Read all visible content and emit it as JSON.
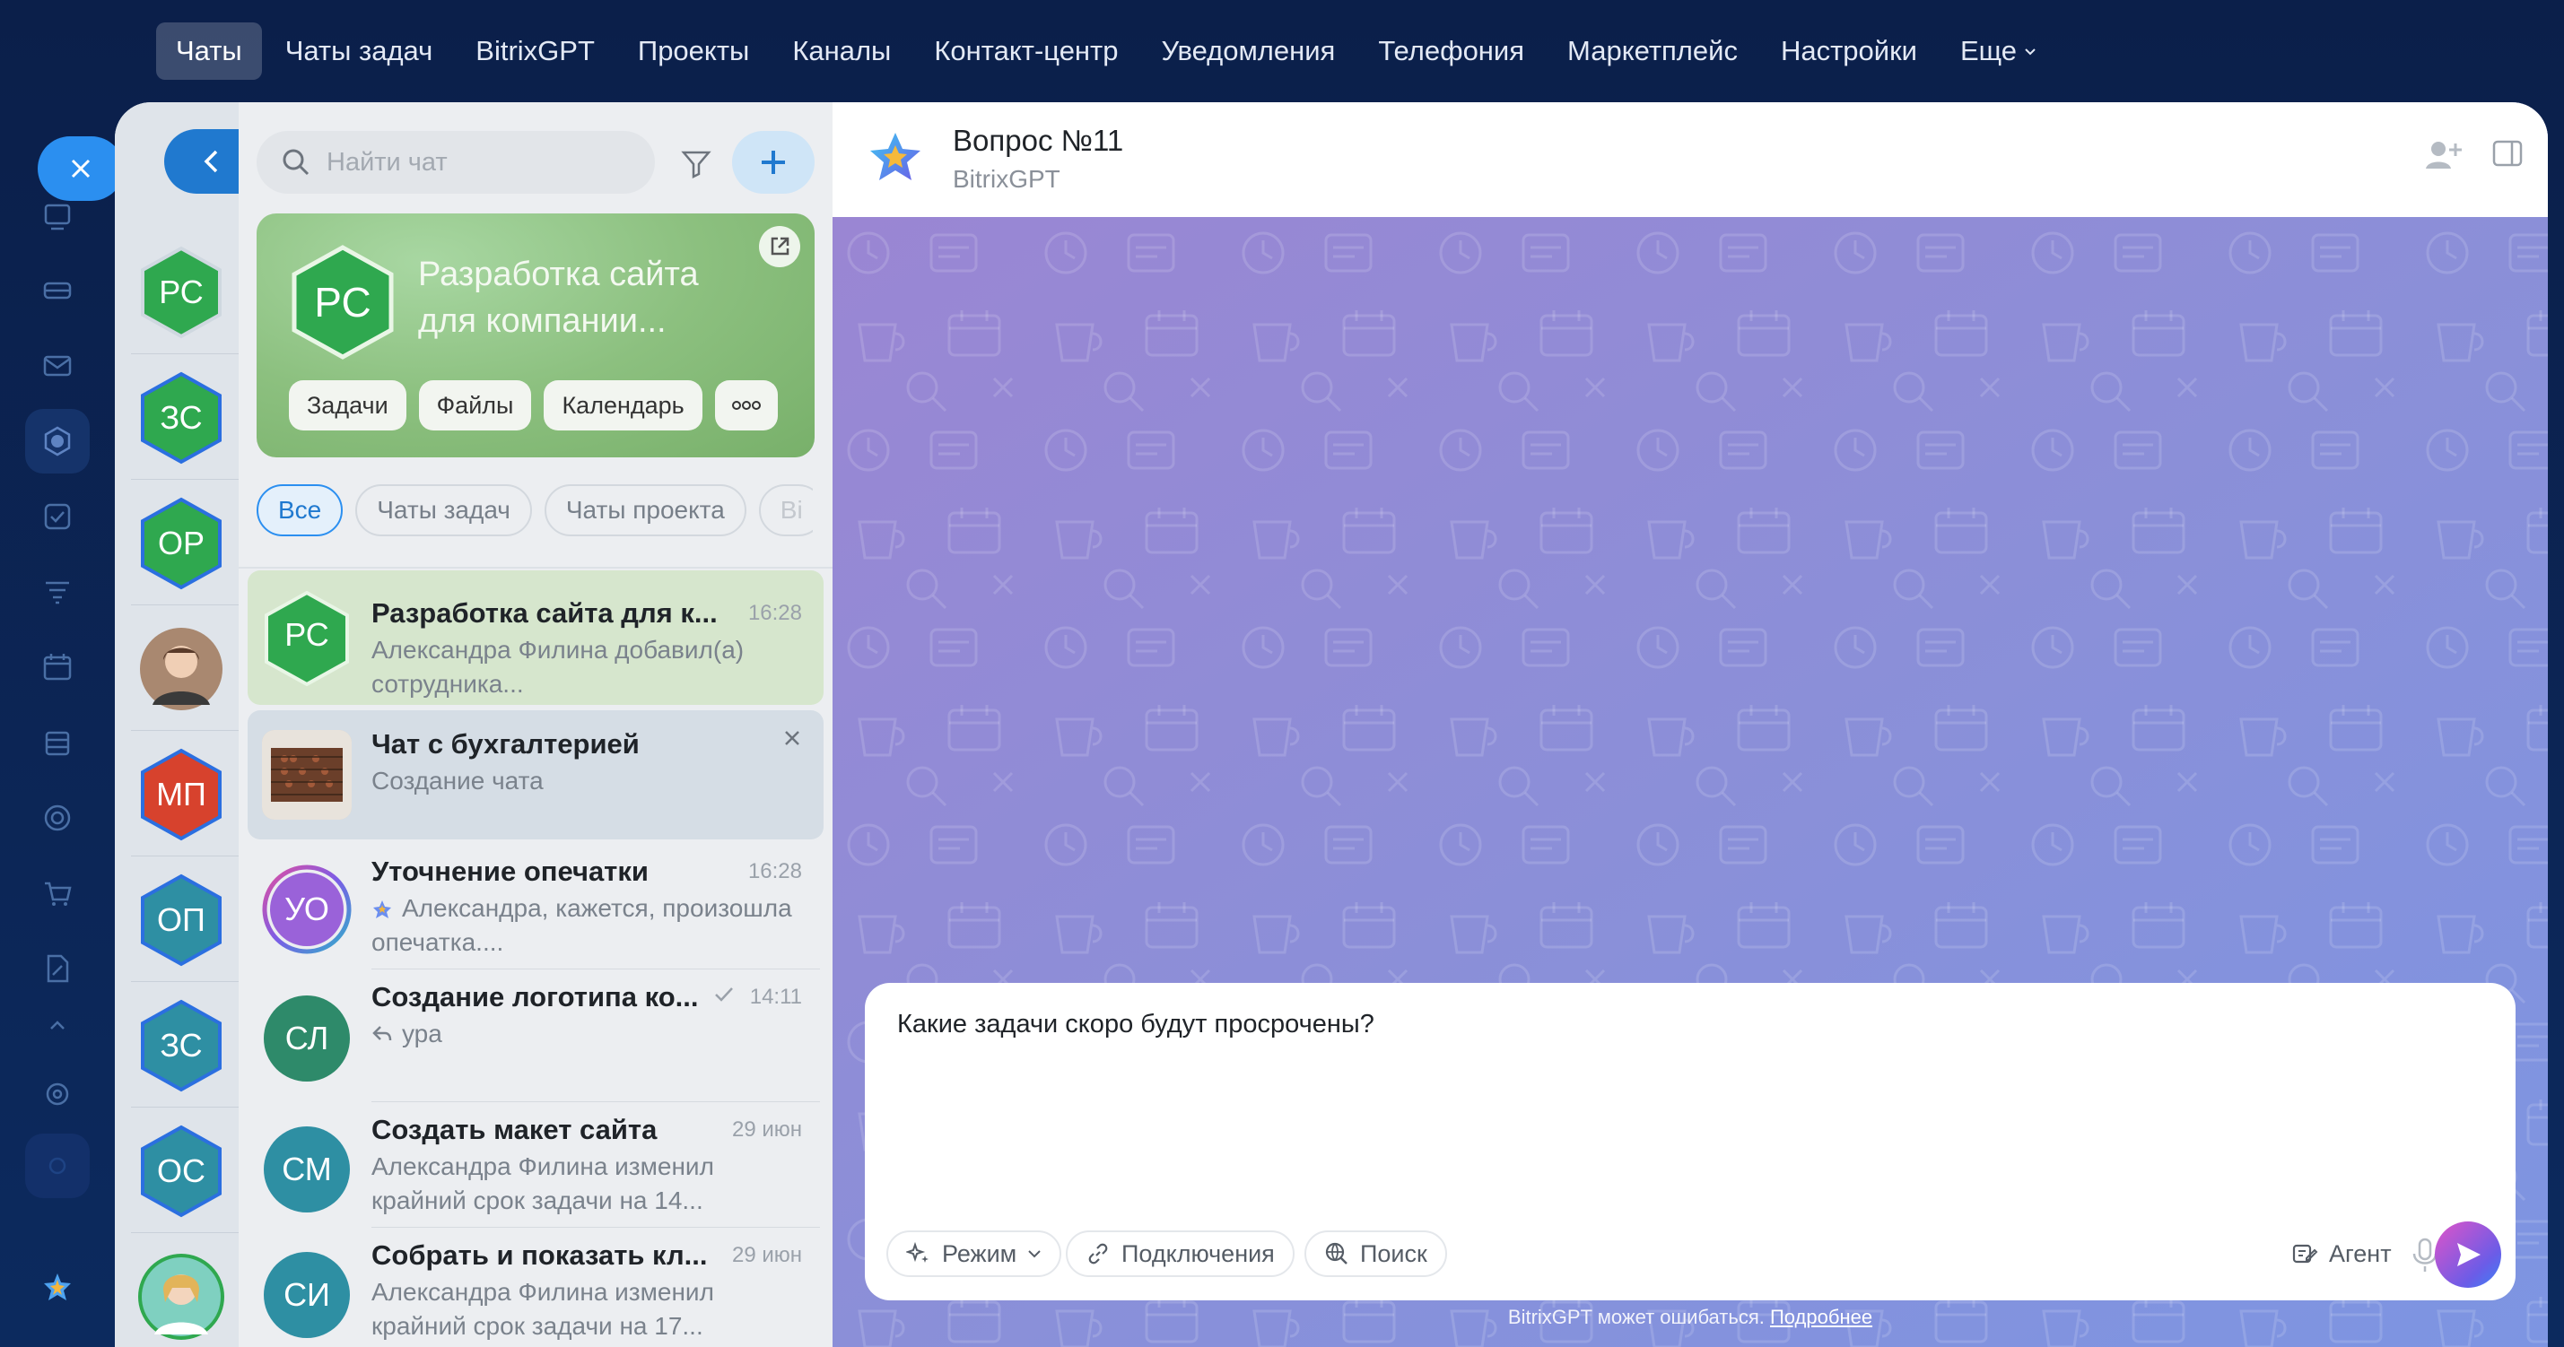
{
  "topnav": {
    "items": [
      "Чаты",
      "Чаты задач",
      "BitrixGPT",
      "Проекты",
      "Каналы",
      "Контакт-центр",
      "Уведомления",
      "Телефония",
      "Маркетплейс",
      "Настройки",
      "Еще"
    ]
  },
  "colors": {
    "accent": "#2b8ff0",
    "green_avatar": "#2fa84f",
    "blue_ring": "#2b6fe0",
    "teal_avatar": "#2e8fa3",
    "red_avatar": "#d7422d",
    "chat_bg": "#8b8fd6"
  },
  "avatars_column": [
    {
      "initials": "РС"
    },
    {
      "initials": "ЗС"
    },
    {
      "initials": "ОР"
    },
    {
      "initials": ""
    },
    {
      "initials": "МП"
    },
    {
      "initials": "ОП"
    },
    {
      "initials": "ЗС"
    },
    {
      "initials": "ОС"
    },
    {
      "initials": ""
    }
  ],
  "search": {
    "placeholder": "Найти чат"
  },
  "project_card": {
    "initials": "РС",
    "title": "Разработка сайта для компании...",
    "buttons": [
      "Задачи",
      "Файлы",
      "Календарь"
    ]
  },
  "filter_chips": [
    "Все",
    "Чаты задач",
    "Чаты проекта",
    "Bi"
  ],
  "chats": [
    {
      "initials": "РС",
      "name": "Разработка сайта для к...",
      "time": "16:28",
      "text": "Александра Филина добавил(а) сотрудника..."
    },
    {
      "initials": "",
      "name": "Чат с бухгалтерией",
      "time": "",
      "text": "Создание чата"
    },
    {
      "initials": "УО",
      "name": "Уточнение опечатки",
      "time": "16:28",
      "text": "Александра, кажется, произошла опечатка...."
    },
    {
      "initials": "СЛ",
      "name": "Создание логотипа ко...",
      "time": "14:11",
      "text": "ура"
    },
    {
      "initials": "СМ",
      "name": "Создать макет сайта",
      "time": "29 июн",
      "text": "Александра Филина изменил крайний срок задачи на 14..."
    },
    {
      "initials": "СИ",
      "name": "Собрать и показать кл...",
      "time": "29 июн",
      "text": "Александра Филина изменил крайний срок задачи на 17..."
    }
  ],
  "chat_header": {
    "title": "Вопрос №11",
    "subtitle": "BitrixGPT"
  },
  "composer": {
    "value": "Какие задачи скоро будут просрочены?",
    "mode_label": "Режим",
    "connections_label": "Подключения",
    "search_label": "Поиск",
    "agent_label": "Агент"
  },
  "disclaimer": {
    "text": "BitrixGPT может ошибаться.",
    "link": "Подробнее"
  }
}
